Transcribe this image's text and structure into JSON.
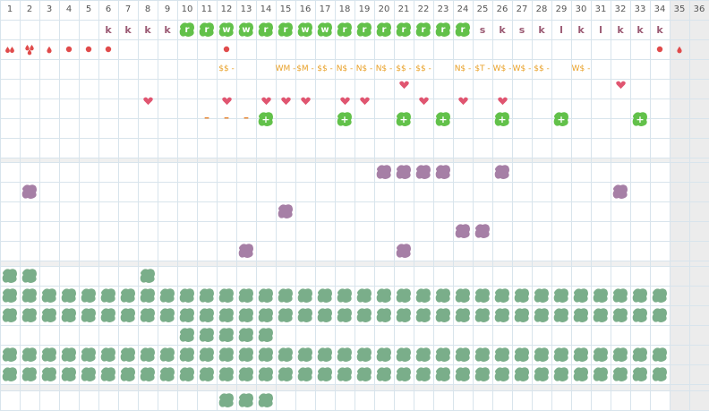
{
  "columns": [
    "1",
    "2",
    "3",
    "4",
    "5",
    "6",
    "7",
    "8",
    "9",
    "10",
    "11",
    "12",
    "13",
    "14",
    "15",
    "16",
    "17",
    "18",
    "19",
    "20",
    "21",
    "22",
    "23",
    "24",
    "25",
    "26",
    "27",
    "28",
    "29",
    "30",
    "31",
    "32",
    "33",
    "34",
    "35",
    "36"
  ],
  "colors": {
    "grid_line": "#d8e4ec",
    "section_gap": "#f0f0f0",
    "end_column": "#ececec",
    "bright_blob": "#62c14a",
    "purple_blob": "#a67fa6",
    "teal_blob": "#7aae8a",
    "letter": "#9b5a73",
    "price": "#e8a027",
    "heart": "#e05570",
    "drop": "#e04b4b"
  },
  "row_letters": [
    {
      "col": 6,
      "text": "k"
    },
    {
      "col": 7,
      "text": "k"
    },
    {
      "col": 8,
      "text": "k"
    },
    {
      "col": 9,
      "text": "k"
    },
    {
      "col": 25,
      "text": "s"
    },
    {
      "col": 26,
      "text": "k"
    },
    {
      "col": 27,
      "text": "s"
    },
    {
      "col": 28,
      "text": "k"
    },
    {
      "col": 29,
      "text": "l"
    },
    {
      "col": 30,
      "text": "k"
    },
    {
      "col": 31,
      "text": "l"
    },
    {
      "col": 32,
      "text": "k"
    },
    {
      "col": 33,
      "text": "k"
    },
    {
      "col": 34,
      "text": "k"
    }
  ],
  "row_bright_blobs": [
    {
      "col": 10,
      "text": "r"
    },
    {
      "col": 11,
      "text": "r"
    },
    {
      "col": 12,
      "text": "w"
    },
    {
      "col": 13,
      "text": "w"
    },
    {
      "col": 14,
      "text": "r"
    },
    {
      "col": 15,
      "text": "r"
    },
    {
      "col": 16,
      "text": "w"
    },
    {
      "col": 17,
      "text": "w"
    },
    {
      "col": 18,
      "text": "r"
    },
    {
      "col": 19,
      "text": "r"
    },
    {
      "col": 20,
      "text": "r"
    },
    {
      "col": 21,
      "text": "r"
    },
    {
      "col": 22,
      "text": "r"
    },
    {
      "col": 23,
      "text": "r"
    },
    {
      "col": 24,
      "text": "r"
    }
  ],
  "row_drops": [
    {
      "col": 1,
      "icon": "double-drop-icon"
    },
    {
      "col": 2,
      "icon": "cluster-drop-icon"
    },
    {
      "col": 3,
      "icon": "drop-icon"
    },
    {
      "col": 4,
      "icon": "dot-icon"
    },
    {
      "col": 5,
      "icon": "dot-icon"
    },
    {
      "col": 6,
      "icon": "dot-icon"
    },
    {
      "col": 12,
      "icon": "dot-icon"
    },
    {
      "col": 34,
      "icon": "dot-icon"
    },
    {
      "col": 35,
      "icon": "drop-icon"
    }
  ],
  "row_prices": [
    {
      "col": 12,
      "text": "$$ -"
    },
    {
      "col": 15,
      "text": "WM -"
    },
    {
      "col": 16,
      "text": "$M -"
    },
    {
      "col": 17,
      "text": "$$ -"
    },
    {
      "col": 18,
      "text": "N$ -"
    },
    {
      "col": 19,
      "text": "N$ -"
    },
    {
      "col": 20,
      "text": "N$ -"
    },
    {
      "col": 21,
      "text": "$$ -"
    },
    {
      "col": 22,
      "text": "$$ -"
    },
    {
      "col": 24,
      "text": "N$ -"
    },
    {
      "col": 25,
      "text": "$T -"
    },
    {
      "col": 26,
      "text": "W$ -"
    },
    {
      "col": 27,
      "text": "W$ -"
    },
    {
      "col": 28,
      "text": "$$ -"
    },
    {
      "col": 30,
      "text": "W$ -"
    }
  ],
  "row_hearts_a": [
    21,
    32
  ],
  "row_hearts_b": [
    8,
    12,
    14,
    15,
    16,
    18,
    19,
    22,
    24,
    26
  ],
  "row_dashes": [
    11,
    12,
    13
  ],
  "row_plus": [
    14,
    18,
    21,
    23,
    26,
    29,
    33
  ],
  "purple_blobs": [
    {
      "row": 0,
      "cols": [
        20,
        21,
        22,
        23,
        26
      ]
    },
    {
      "row": 1,
      "cols": [
        2,
        32
      ]
    },
    {
      "row": 2,
      "cols": [
        15
      ]
    },
    {
      "row": 3,
      "cols": [
        24,
        25
      ]
    },
    {
      "row": 4,
      "cols": [
        13,
        21
      ]
    }
  ],
  "teal_rows": [
    {
      "row": 0,
      "from": 1,
      "to": 2,
      "extra": [
        8
      ]
    },
    {
      "row": 1,
      "from": 1,
      "to": 34
    },
    {
      "row": 2,
      "from": 1,
      "to": 34
    },
    {
      "row": 3,
      "from": 10,
      "to": 14
    },
    {
      "row": 4,
      "from": 1,
      "to": 34
    },
    {
      "row": 5,
      "from": 1,
      "to": 34
    }
  ],
  "bottom_teal": [
    12,
    13,
    14
  ]
}
